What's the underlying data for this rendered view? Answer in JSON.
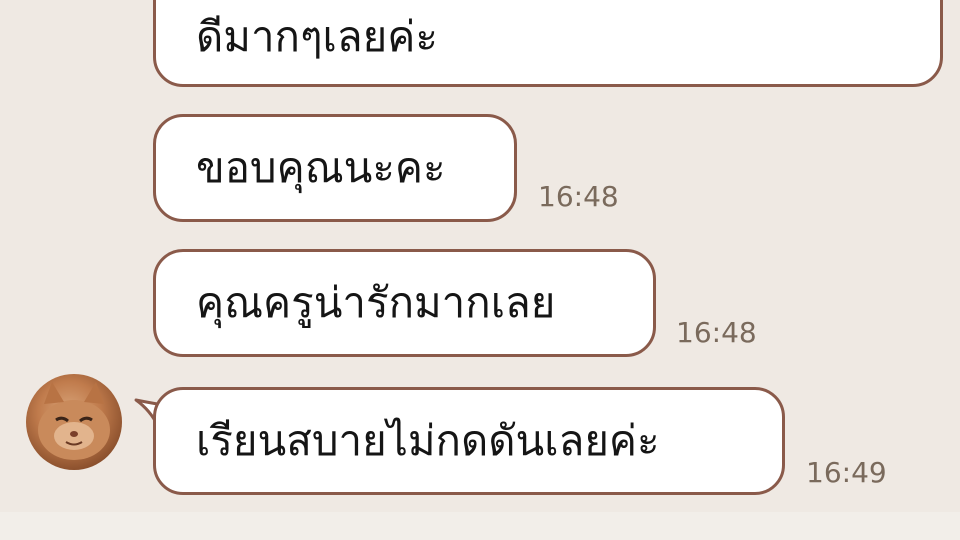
{
  "messages": [
    {
      "text": "ดีมากๆเลยค่ะ",
      "time": ""
    },
    {
      "text": "ขอบคุณนะคะ",
      "time": "16:48"
    },
    {
      "text": "คุณครูน่ารักมากเลย",
      "time": "16:48"
    },
    {
      "text": "เรียนสบายไม่กดดันเลยค่ะ",
      "time": "16:49"
    }
  ],
  "sender": {
    "avatar_icon": "cat-avatar-icon"
  },
  "colors": {
    "background": "#efe9e3",
    "bubble_border": "#8a5a4a",
    "bubble_fill": "#ffffff",
    "time_text": "#7a6a5c"
  }
}
